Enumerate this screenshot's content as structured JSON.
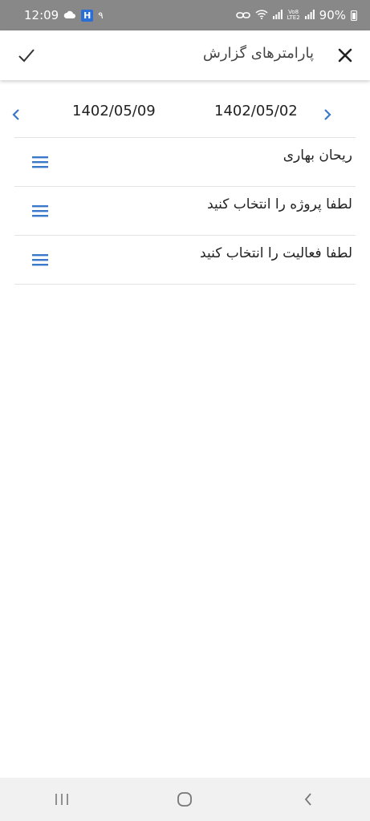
{
  "status_bar": {
    "time": "12:09",
    "app_badge": "H",
    "notification_count": "۹",
    "net_label": "Vo8\nLTE2",
    "battery": "90%"
  },
  "header": {
    "title": "پارامترهای گزارش"
  },
  "date_range": {
    "start": "1402/05/02",
    "end": "1402/05/09"
  },
  "rows": [
    {
      "label": "ریحان بهاری"
    },
    {
      "label": "لطفا پروژه را انتخاب کنید"
    },
    {
      "label": "لطفا فعالیت را انتخاب کنید"
    }
  ],
  "colors": {
    "accent": "#3a78c9",
    "status_bar": "#888888",
    "nav_bar": "#f1f1f1"
  }
}
